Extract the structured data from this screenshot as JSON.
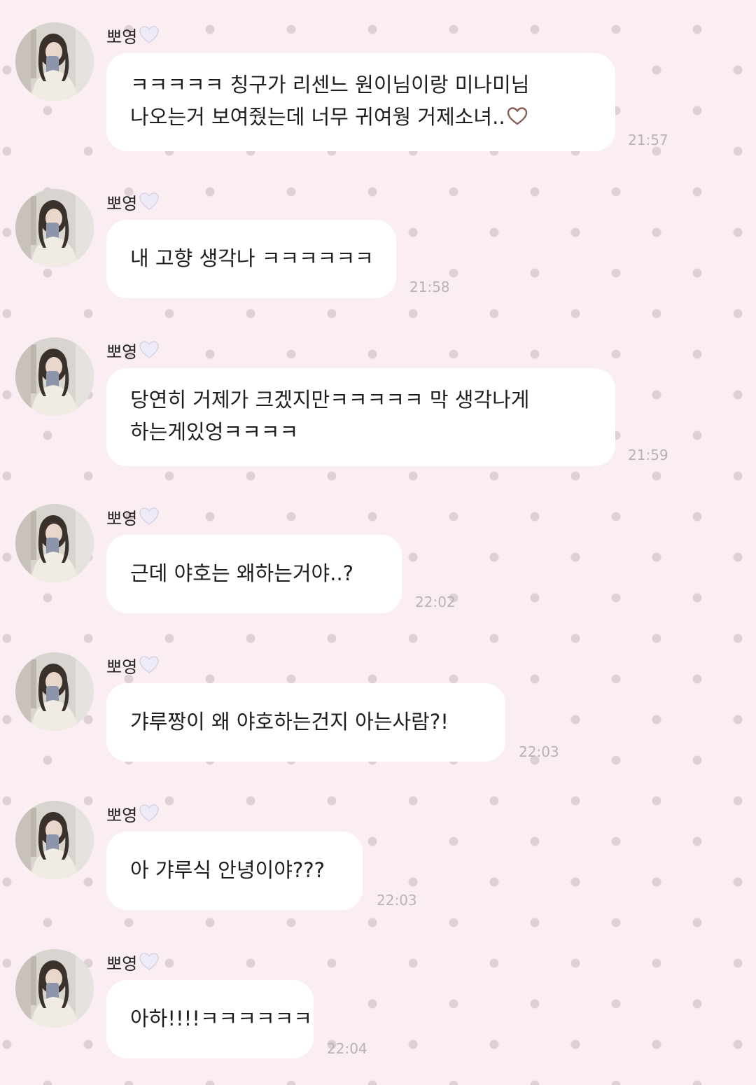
{
  "colors": {
    "background": "#fbeef2",
    "dot": "#ded1d6",
    "bubble": "#ffffff",
    "timestamp": "#b8b2b4",
    "sender_heart": "#eeeaf7"
  },
  "messages": [
    {
      "sender": "뽀영",
      "sender_icon": "white-heart-icon",
      "lines": [
        "ㅋㅋㅋㅋㅋ 칭구가 리센느 원이님이랑 미나미님",
        "나오는거 보여줬는데 너무 귀여웡 거제소녀.."
      ],
      "trailing_icon": "heart-outline-icon",
      "time": "21:57"
    },
    {
      "sender": "뽀영",
      "sender_icon": "white-heart-icon",
      "lines": [
        "내 고향 생각나 ㅋㅋㅋㅋㅋㅋ"
      ],
      "time": "21:58"
    },
    {
      "sender": "뽀영",
      "sender_icon": "white-heart-icon",
      "lines": [
        "당연히 거제가 크겠지만ㅋㅋㅋㅋㅋ 막 생각나게",
        "하는게있엉ㅋㅋㅋㅋ"
      ],
      "time": "21:59"
    },
    {
      "sender": "뽀영",
      "sender_icon": "white-heart-icon",
      "lines": [
        "근데 야호는 왜하는거야..?"
      ],
      "time": "22:02"
    },
    {
      "sender": "뽀영",
      "sender_icon": "white-heart-icon",
      "lines": [
        "갸루짱이 왜 야호하는건지 아는사람?!"
      ],
      "time": "22:03"
    },
    {
      "sender": "뽀영",
      "sender_icon": "white-heart-icon",
      "lines": [
        "아 갸루식 안녕이야???"
      ],
      "time": "22:03"
    },
    {
      "sender": "뽀영",
      "sender_icon": "white-heart-icon",
      "lines": [
        "아하!!!!ㅋㅋㅋㅋㅋㅋ"
      ],
      "time": "22:04"
    }
  ]
}
